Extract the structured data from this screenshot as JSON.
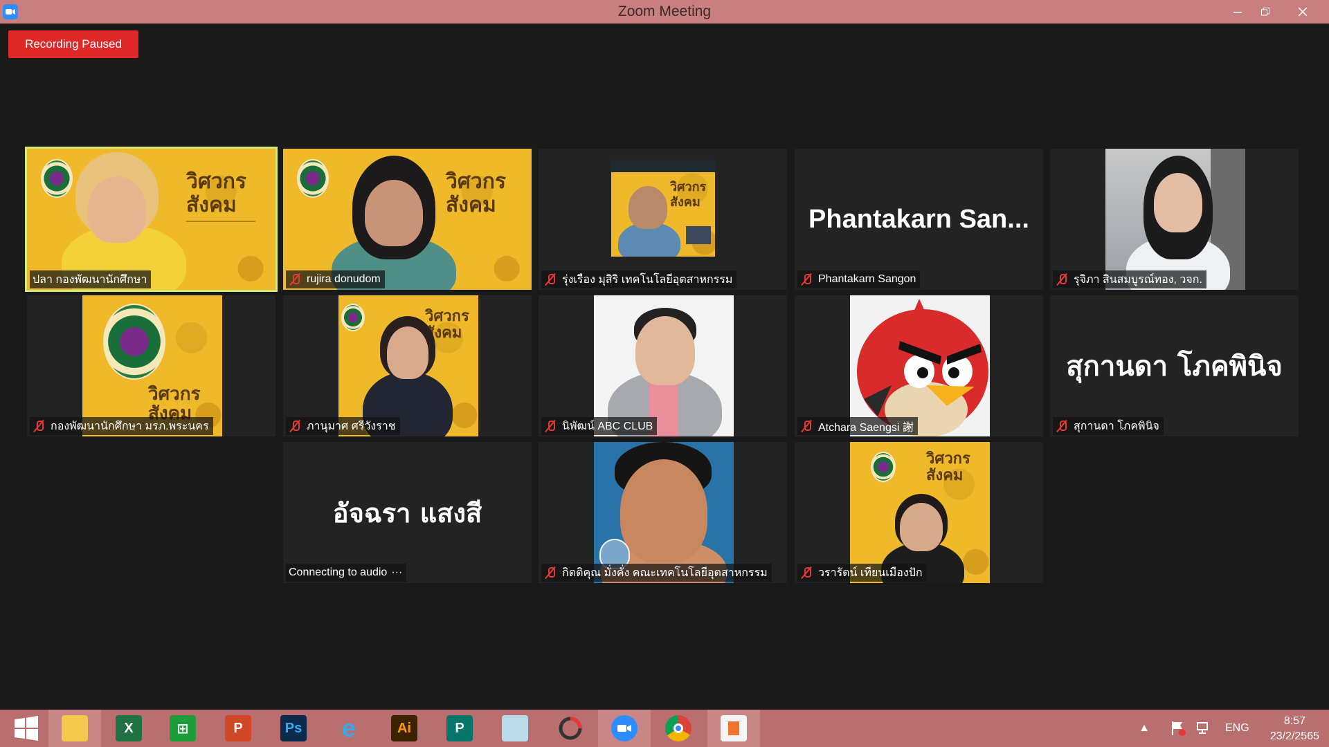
{
  "window": {
    "title": "Zoom Meeting",
    "app_icon": "zoom-camera-icon",
    "controls": [
      "minimize-icon",
      "restore-icon",
      "close-icon"
    ]
  },
  "recording": {
    "label": "Recording Paused",
    "color": "#e02828"
  },
  "participants": [
    {
      "name": "ปลา กองพัฒนานักศึกษา",
      "muted": false,
      "active_speaker": true
    },
    {
      "name": "rujira donudom",
      "muted": true
    },
    {
      "name": "รุ่งเรือง มุสิริ เทคโนโลยีอุตสาหกรรม",
      "muted": true
    },
    {
      "name": "Phantakarn Sangon",
      "muted": true,
      "display_name": "Phantakarn San..."
    },
    {
      "name": "รุจิภา สินสมบูรณ์ทอง, วจก.",
      "muted": true
    },
    {
      "name": "กองพัฒนานักศึกษา มรภ.พระนคร",
      "muted": true
    },
    {
      "name": "ภานุมาศ ศรีวังราช",
      "muted": true
    },
    {
      "name": "นิพัฒน์ ABC CLUB",
      "muted": true
    },
    {
      "name": "Atchara Saengsi 謝",
      "muted": true
    },
    {
      "name": "สุกานดา โภคพินิจ",
      "muted": true,
      "display_name": "สุกานดา โภคพินิจ"
    },
    {
      "name": "Connecting to audio",
      "muted": false,
      "display_name": "อัจฉรา แสงสี",
      "status_suffix": "···"
    },
    {
      "name": "กิตติคุณ มั่งคั่ง คณะเทคโนโลยีอุตสาหกรรม",
      "muted": true
    },
    {
      "name": "วรารัตน์ เทียนเมืองปัก",
      "muted": true
    }
  ],
  "poster_text": {
    "line1": "วิศวกร",
    "line2": "สังคม"
  },
  "taskbar": {
    "apps": [
      {
        "icon": "windows-start-icon"
      },
      {
        "icon": "file-explorer-icon"
      },
      {
        "icon": "excel-icon",
        "glyph": "X"
      },
      {
        "icon": "store-icon"
      },
      {
        "icon": "powerpoint-icon",
        "glyph": "P"
      },
      {
        "icon": "photoshop-icon",
        "glyph": "Ps"
      },
      {
        "icon": "internet-explorer-icon",
        "glyph": "e"
      },
      {
        "icon": "illustrator-icon",
        "glyph": "Ai"
      },
      {
        "icon": "publisher-icon",
        "glyph": "P"
      },
      {
        "icon": "notepad-icon"
      },
      {
        "icon": "photoscape-icon"
      },
      {
        "icon": "zoom-icon"
      },
      {
        "icon": "chrome-icon"
      },
      {
        "icon": "gallery-icon"
      }
    ],
    "tray": {
      "language": "ENG",
      "time": "8:57",
      "date": "23/2/2565"
    }
  }
}
